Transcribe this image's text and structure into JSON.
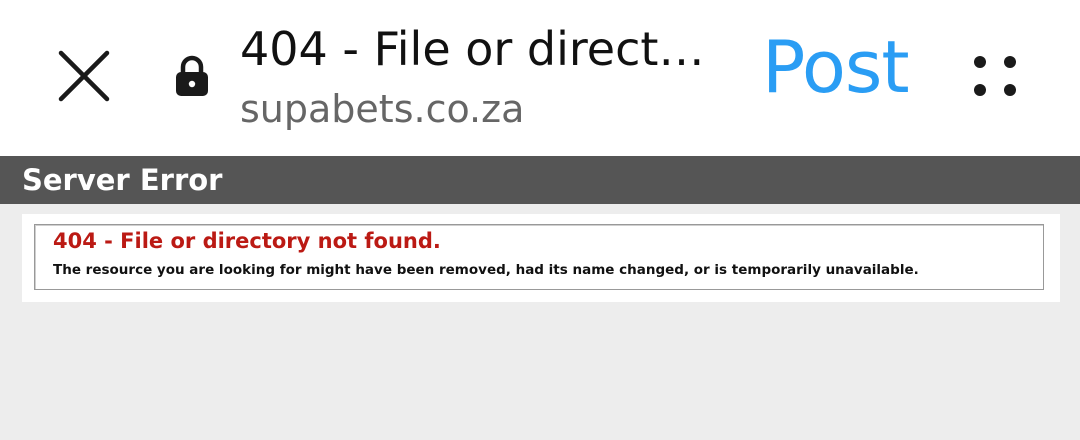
{
  "browser_bar": {
    "close_icon": "close-icon",
    "lock_icon": "lock-icon",
    "page_title": "404 - File or directo…",
    "domain": "supabets.co.za",
    "post_label": "Post",
    "post_color": "#2a9df4",
    "more_icon": "four-dots-icon"
  },
  "page": {
    "header_title": "Server Error",
    "error_heading": "404 - File or directory not found.",
    "error_detail": "The resource you are looking for might have been removed, had its name changed, or is temporarily unavailable.",
    "header_color": "#555555",
    "error_color": "#bb1a14"
  }
}
